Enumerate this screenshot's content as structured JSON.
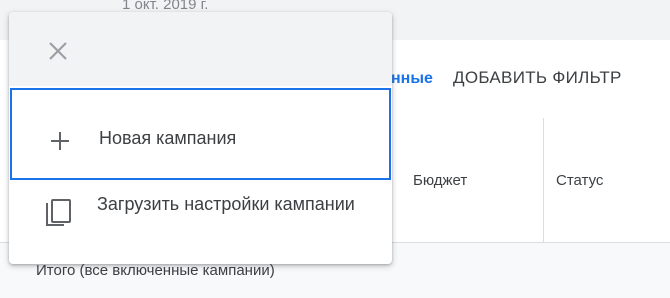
{
  "header": {
    "date": "1 окт. 2019 г."
  },
  "filters": {
    "link_fragment": "нные",
    "add_filter_label": "ДОБАВИТЬ ФИЛЬТР"
  },
  "table": {
    "columns": [
      "Бюджет",
      "Статус"
    ],
    "total_row_label": "Итого (все включенные кампании)"
  },
  "menu": {
    "close_icon": "close-icon",
    "items": [
      {
        "label": "Новая кампания",
        "icon": "plus-icon",
        "selected": true
      },
      {
        "label": "Загрузить настройки кампании",
        "icon": "copy-icon",
        "selected": false
      }
    ]
  },
  "colors": {
    "accent": "#1a73e8",
    "text": "#3c4043",
    "muted": "#80868b",
    "header_bg": "#f1f3f4"
  }
}
